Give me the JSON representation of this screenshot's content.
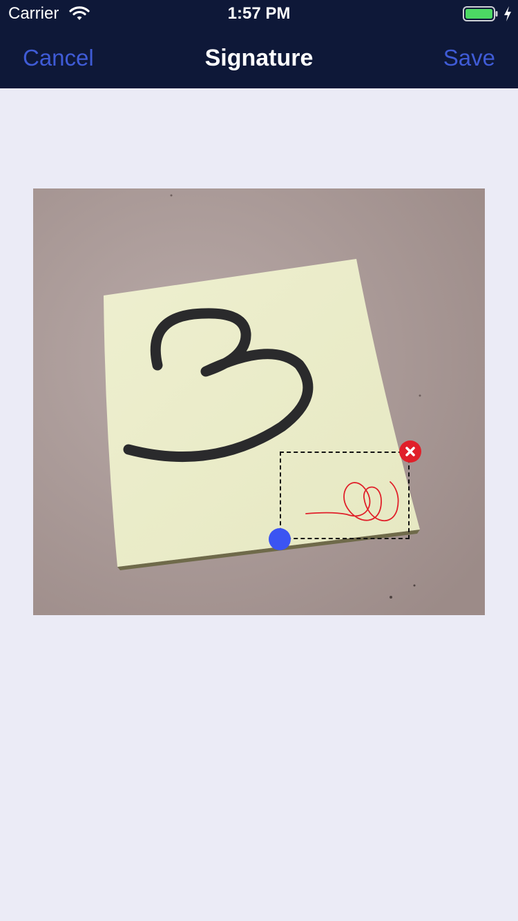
{
  "status_bar": {
    "carrier": "Carrier",
    "time": "1:57 PM",
    "wifi_icon": "wifi-icon",
    "battery_icon": "battery-charging-icon"
  },
  "nav": {
    "cancel_label": "Cancel",
    "title": "Signature",
    "save_label": "Save"
  },
  "editor": {
    "delete_icon": "close-icon"
  },
  "colors": {
    "header_bg": "#0e1838",
    "accent": "#3f5bd6",
    "page_bg": "#ebebf6",
    "signature_ink": "#e0202a",
    "resize_handle": "#3b54f2",
    "battery_fill": "#4cd964"
  }
}
